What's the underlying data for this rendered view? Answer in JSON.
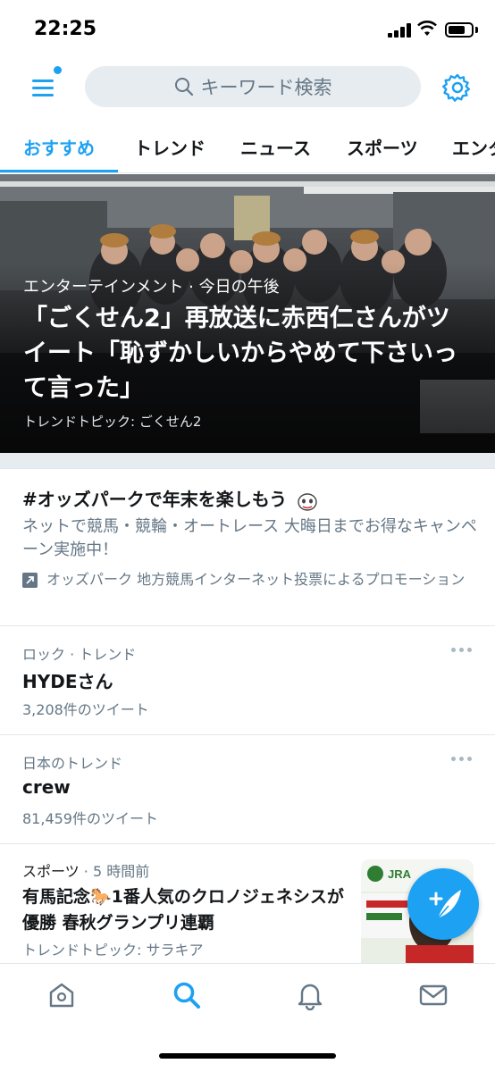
{
  "status_bar": {
    "time": "22:25"
  },
  "top_bar": {
    "menu_icon": "hamburger-menu-icon",
    "search": {
      "placeholder": "キーワード検索",
      "icon": "search-icon"
    },
    "settings_icon": "gear-icon"
  },
  "tabs": [
    {
      "label": "おすすめ",
      "active": true
    },
    {
      "label": "トレンド"
    },
    {
      "label": "ニュース"
    },
    {
      "label": "スポーツ"
    },
    {
      "label": "エンタ"
    }
  ],
  "hero": {
    "meta": "エンターテインメント · 今日の午後",
    "title": "「ごくせん2」再放送に赤西仁さんがツイート「恥ずかしいからやめて下さいって言った」",
    "topic": "トレンドトピック: ごくせん2"
  },
  "promo": {
    "title": "#オッズパークで年末を楽しもう",
    "description": "ネットで競馬・競輪・オートレース 大晦日までお得なキャンペーン実施中！",
    "promoted_by": "オッズパーク 地方競馬インターネット投票によるプロモーション",
    "promoted_icon": "promoted-arrow-icon"
  },
  "trends": [
    {
      "category": "ロック · トレンド",
      "name": "HYDEさん",
      "count": "3,208件のツイート"
    },
    {
      "category": "日本のトレンド",
      "name": "crew",
      "count": "81,459件のツイート"
    }
  ],
  "story": {
    "category": "スポーツ",
    "time": " · 5 時間前",
    "title": "有馬記念🐎1番人気のクロノジェネシスが優勝 春秋グランプリ連覇",
    "topic": "トレンドトピック: サラキア",
    "thumb_text": "JRA"
  },
  "fab_icon": "compose-tweet-icon",
  "bottom_nav": [
    {
      "icon": "home-icon"
    },
    {
      "icon": "search-icon",
      "active": true
    },
    {
      "icon": "notifications-bell-icon"
    },
    {
      "icon": "messages-envelope-icon"
    }
  ],
  "colors": {
    "accent": "#1da1f2",
    "text": "#14171a",
    "secondary": "#657786",
    "divider": "#e1e8ed"
  }
}
